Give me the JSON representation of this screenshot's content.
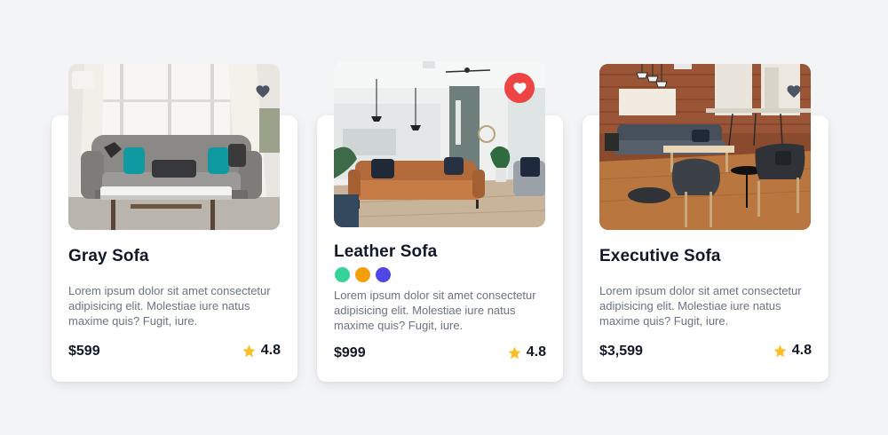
{
  "colors": {
    "background": "#f3f4f6",
    "card": "#ffffff",
    "heart_inactive": "#4b5563",
    "heart_active_bg": "#ef4444",
    "star": "#fbbf24"
  },
  "products": [
    {
      "title": "Gray Sofa",
      "image": "gray-sofa-living-room",
      "description": "Lorem ipsum dolor sit amet consectetur adipisicing elit. Molestiae iure natus maxime quis? Fugit, iure.",
      "price": "$599",
      "rating": "4.8",
      "favorite": false
    },
    {
      "title": "Leather Sofa",
      "image": "leather-sofa-open-living-room",
      "description": "Lorem ipsum dolor sit amet consectetur adipisicing elit. Molestiae iure natus maxime quis? Fugit, iure.",
      "price": "$999",
      "rating": "4.8",
      "favorite": true,
      "color_options": [
        "#34d399",
        "#f59e0b",
        "#4f46e5"
      ]
    },
    {
      "title": "Executive Sofa",
      "image": "executive-lounge-brick-wall",
      "description": "Lorem ipsum dolor sit amet consectetur adipisicing elit. Molestiae iure natus maxime quis? Fugit, iure.",
      "price": "$3,599",
      "rating": "4.8",
      "favorite": false
    }
  ]
}
